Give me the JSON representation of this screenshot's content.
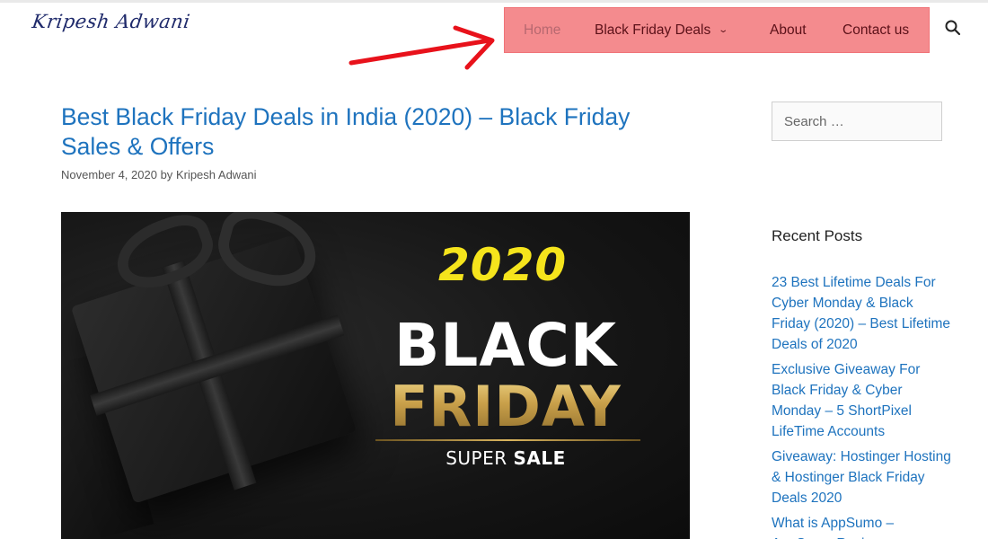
{
  "site": {
    "logo_text": "Kripesh Adwani"
  },
  "nav": {
    "items": [
      {
        "label": "Home"
      },
      {
        "label": "Black Friday Deals"
      },
      {
        "label": "About"
      },
      {
        "label": "Contact us"
      }
    ],
    "dropdown_icon": "chevron-down-icon",
    "search_icon": "search-icon",
    "highlight_color": "#f48b8e",
    "annotation_arrow_color": "#e8121b"
  },
  "post": {
    "title": "Best Black Friday Deals in India (2020) – Black Friday Sales & Offers",
    "date": "November 4, 2020",
    "by": "by",
    "author": "Kripesh Adwani",
    "hero": {
      "year": "2020",
      "line1": "BLACK",
      "line2": "FRIDAY",
      "sale_prefix": "SUPER",
      "sale_word": "SALE"
    }
  },
  "sidebar": {
    "search_placeholder": "Search …",
    "recent_title": "Recent Posts",
    "recent_posts": [
      "23 Best Lifetime Deals For Cyber Monday & Black Friday (2020) – Best Lifetime Deals of 2020",
      "Exclusive Giveaway For Black Friday & Cyber Monday – 5 ShortPixel LifeTime Accounts",
      "Giveaway: Hostinger Hosting & Hostinger Black Friday Deals 2020",
      "What is AppSumo – AppSumo Review"
    ]
  },
  "colors": {
    "link": "#1e73be",
    "hero_year": "#f5e41c",
    "hero_gold": "#c9a24a"
  }
}
